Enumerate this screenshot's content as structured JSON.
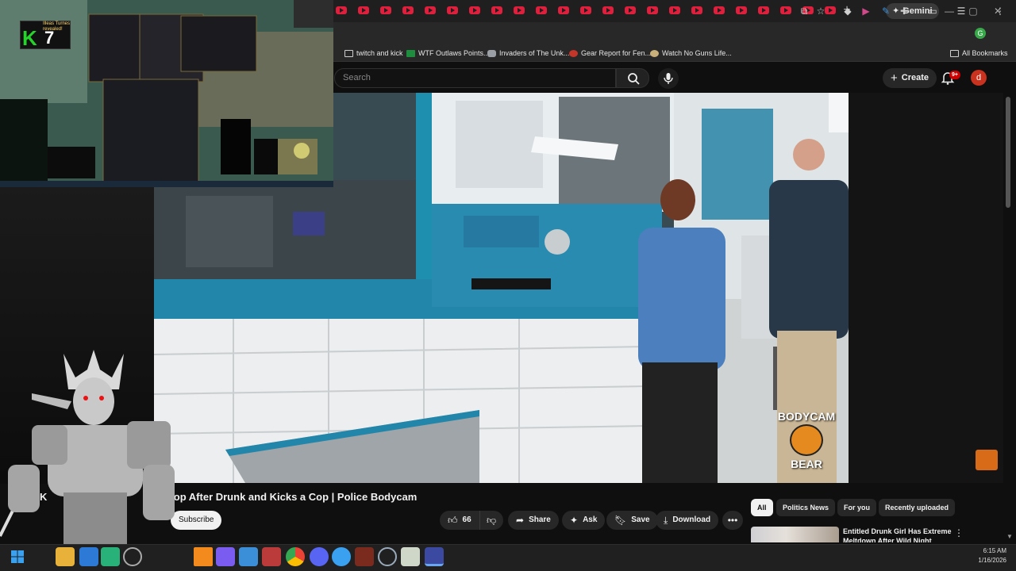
{
  "browser": {
    "tab_icon_count": 23,
    "new_tab_label": "+",
    "gemini_label": "Gemini",
    "window_controls": {
      "minimize": "—",
      "maximize": "▢",
      "close": "✕"
    },
    "profile_initial": "G"
  },
  "bookmarks": {
    "items": [
      {
        "label": "twitch and kick",
        "icon": "folder-icon"
      },
      {
        "label": "WTF Outlaws Points...",
        "icon": "sheets-icon"
      },
      {
        "label": "Invaders of The Unk...",
        "icon": "controller-icon"
      },
      {
        "label": "Gear Report for Fen...",
        "icon": "warcraftlogs-icon"
      },
      {
        "label": "Watch No Guns Life...",
        "icon": "anime-icon"
      }
    ],
    "all_bookmarks_label": "All Bookmarks"
  },
  "youtube": {
    "search_placeholder": "Search",
    "create_label": "Create",
    "notification_badge": "9+",
    "avatar_initial": "d"
  },
  "video": {
    "title_visible": "Cop After Drunk and Kicks a Cop | Police Bodycam",
    "title_prefix_char": "K",
    "watermark_line1": "BODYCAM",
    "watermark_line2": "BEAR"
  },
  "actions": {
    "like_count": "66",
    "share_label": "Share",
    "ask_label": "Ask",
    "save_label": "Save",
    "download_label": "Download",
    "subscribe_label": "Subscribe"
  },
  "chips": [
    "All",
    "Politics News",
    "For you",
    "Recently uploaded"
  ],
  "recommendation": {
    "title": "Entitled Drunk Girl Has Extreme Meltdown After Wild Night"
  },
  "game": {
    "kill_letter": "K",
    "kill_count": "7",
    "toast_text": "Illeas Turnes revealed!"
  },
  "taskbar": {
    "time": "6:15 AM",
    "date": "1/16/2026"
  },
  "colors": {
    "accent_red": "#cc0000",
    "youtube_bg": "#0f0f0f",
    "subscribe_bg": "#f1f1f1",
    "kill_green": "#26d32b"
  }
}
